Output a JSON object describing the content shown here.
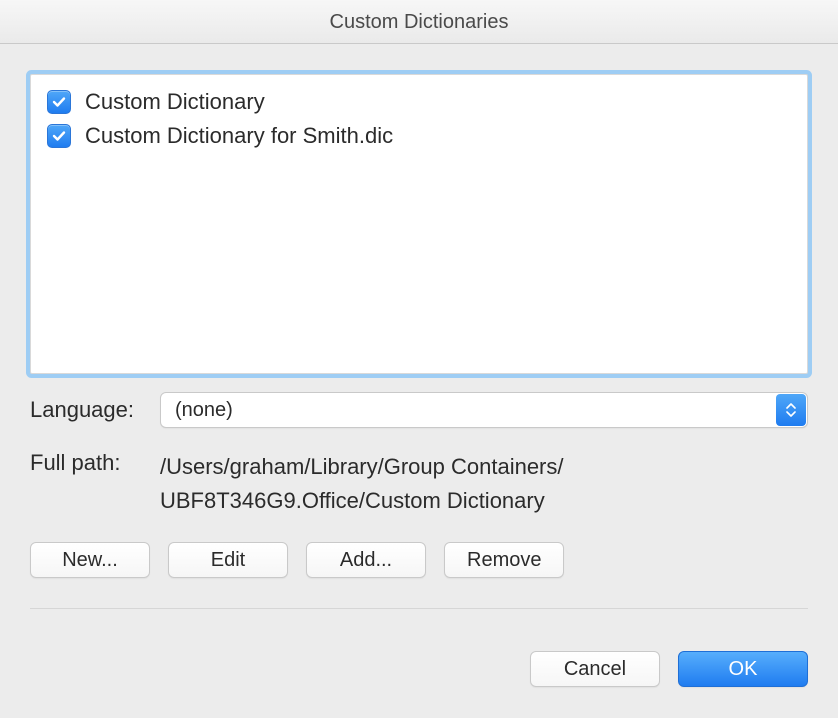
{
  "window": {
    "title": "Custom Dictionaries"
  },
  "list": {
    "items": [
      {
        "checked": true,
        "label": "Custom Dictionary"
      },
      {
        "checked": true,
        "label": "Custom Dictionary for Smith.dic"
      }
    ]
  },
  "language": {
    "label": "Language:",
    "value": "(none)"
  },
  "full_path": {
    "label": "Full path:",
    "value": "/Users/graham/Library/Group Containers/\nUBF8T346G9.Office/Custom Dictionary"
  },
  "buttons": {
    "new": "New...",
    "edit": "Edit",
    "add": "Add...",
    "remove": "Remove"
  },
  "footer": {
    "cancel": "Cancel",
    "ok": "OK"
  }
}
